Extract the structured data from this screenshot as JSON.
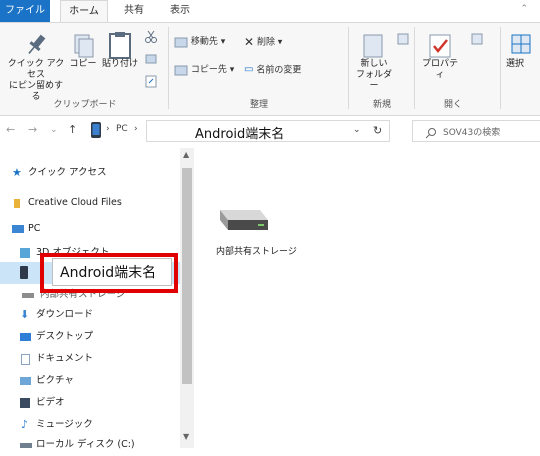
{
  "ribbon_tabs": {
    "file": "ファイル",
    "home": "ホーム",
    "share": "共有",
    "view": "表示"
  },
  "clipboard": {
    "pin_label": "クイック アクセス\nにピン留めする",
    "copy_label": "コピー",
    "paste_label": "貼り付け",
    "group_label": "クリップボード"
  },
  "organize": {
    "move_label": "移動先 ▾",
    "copy_to_label": "コピー先 ▾",
    "delete_label": "削除 ▾",
    "rename_label": "名前の変更",
    "group_label": "整理"
  },
  "new": {
    "new_folder_label": "新しい\nフォルダー",
    "group_label": "新規"
  },
  "open": {
    "properties_label": "プロパティ",
    "group_label": "開く"
  },
  "select": {
    "select_label": "選択"
  },
  "address": {
    "pc_label": "PC",
    "current": "Android端末名"
  },
  "search": {
    "placeholder": "SOV43の検索"
  },
  "nav": {
    "quick_access": "クイック アクセス",
    "creative_cloud": "Creative Cloud Files",
    "pc": "PC",
    "objects3d": "3D オブジェクト",
    "internal_storage": "内部共有ストレージ",
    "downloads": "ダウンロード",
    "desktop": "デスクトップ",
    "documents": "ドキュメント",
    "pictures": "ピクチャ",
    "videos": "ビデオ",
    "music": "ミュージック",
    "local_disk": "ローカル ディスク (C:)"
  },
  "callout": {
    "label": "Android端末名"
  },
  "content": {
    "drive_label": "内部共有ストレージ"
  },
  "colors": {
    "file_tab": "#1a73c6",
    "highlight": "#e10000"
  }
}
